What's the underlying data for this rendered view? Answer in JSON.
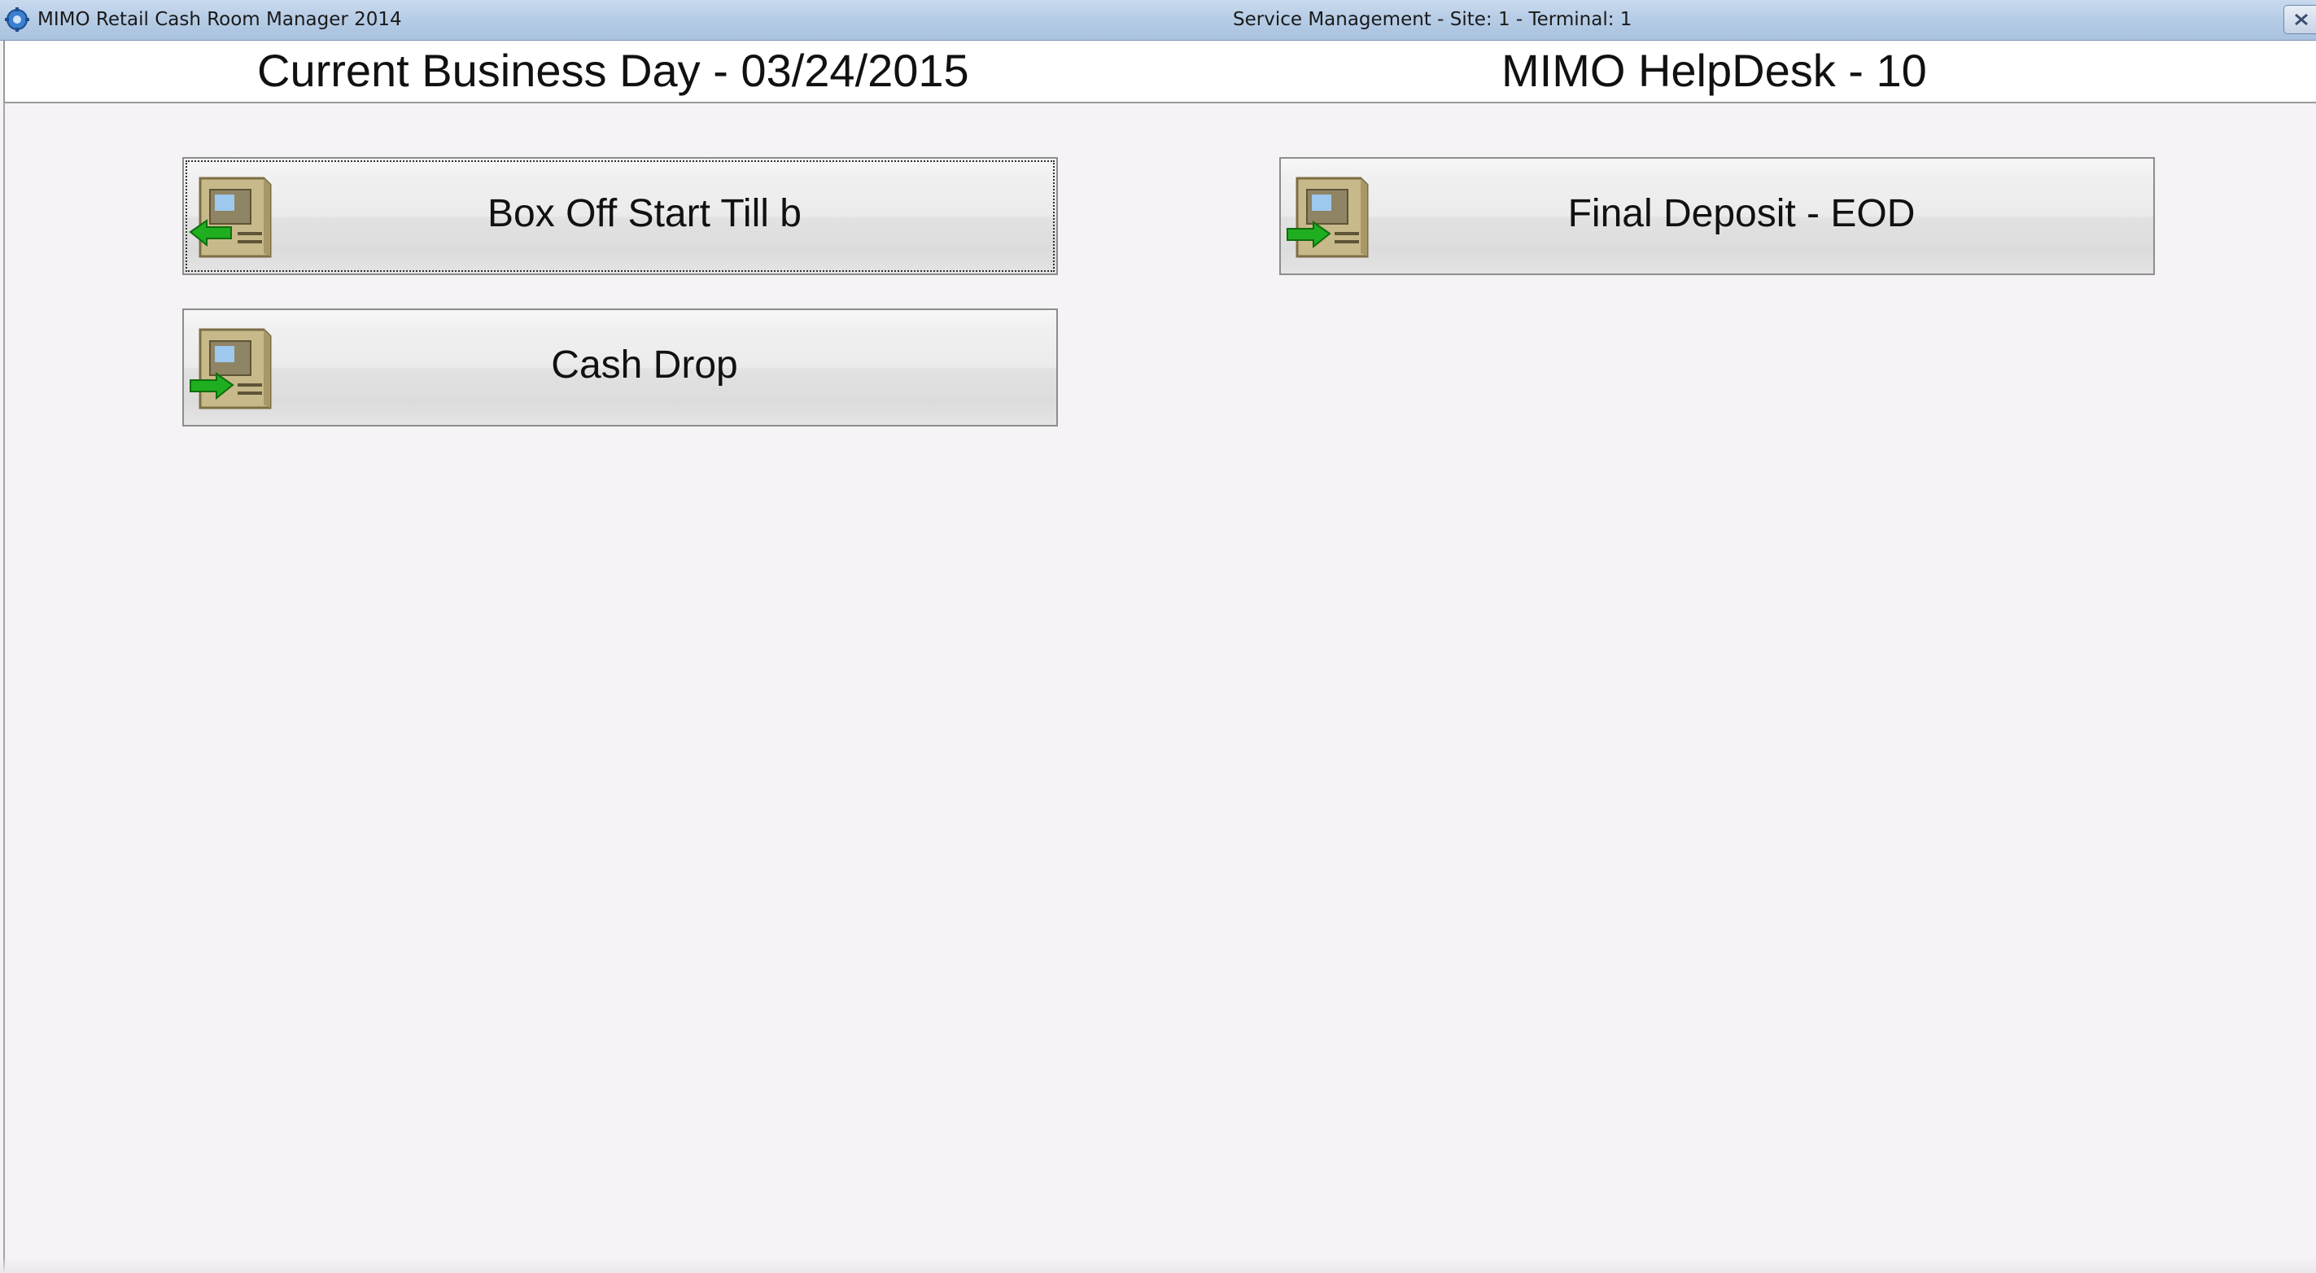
{
  "titlebar": {
    "app_title": "MIMO Retail Cash Room Manager 2014",
    "window_subtitle": "Service Management - Site: 1 - Terminal: 1",
    "app_icon": "gear-globe-icon",
    "close_icon": "close-icon"
  },
  "header": {
    "business_day": "Current Business Day - 03/24/2015",
    "helpdesk": "MIMO HelpDesk - 10"
  },
  "actions": [
    {
      "label": "Box Off Start Till b",
      "icon": "atm-arrow-left-icon",
      "focused": true
    },
    {
      "label": "Cash Drop",
      "icon": "atm-arrow-right-icon",
      "focused": false
    },
    {
      "label": "Final Deposit - EOD",
      "icon": "atm-arrow-right-icon",
      "focused": false
    }
  ],
  "colors": {
    "background": "#f6f3f6",
    "titlebar": "#b7cde6",
    "arrow_green": "#1fae1f",
    "atm_body": "#cdbf92"
  }
}
